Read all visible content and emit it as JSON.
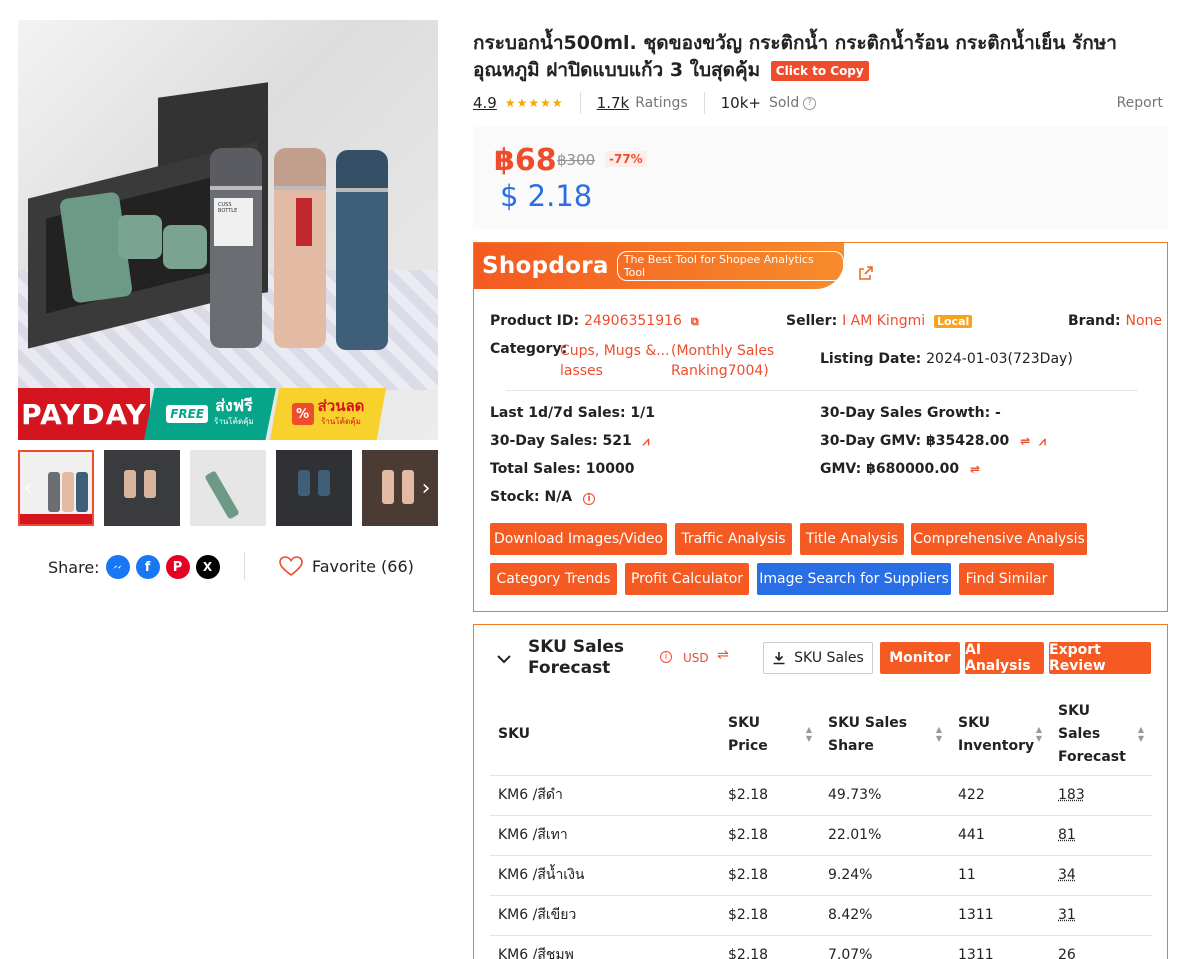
{
  "product": {
    "title": "กระบอกน้ำ500ml. ชุดของขวัญ กระติกน้ำ กระติกน้ำร้อน กระติกน้ำเย็น รักษาอุณหภูมิ ฝาปิดแบบแก้ว 3 ใบสุดคุ้ม",
    "copy_label": "Click to Copy",
    "rating": "4.9",
    "stars": "★★★★★",
    "ratings_count": "1.7k",
    "ratings_label": "Ratings",
    "sold_count": "10k+",
    "sold_label": "Sold",
    "report_label": "Report",
    "price": "฿68",
    "original_price": "฿300",
    "discount": "-77%",
    "price_usd": "$ 2.18"
  },
  "gallery": {
    "banner": {
      "payday": "PAYDAY",
      "free": "FREE",
      "free_ship": "ส่งฟรี",
      "free_ship_sub": "ร้านโค้ดคุ้ม",
      "discount": "ส่วนลด",
      "discount_sub": "ร้านโค้ดคุ้ม",
      "percent": "%"
    },
    "bottle_label": "CUSS BOTTLE",
    "prev_icon": "‹",
    "next_icon": "›"
  },
  "share": {
    "label": "Share:",
    "favorite_label": "Favorite (66)"
  },
  "shopdora": {
    "logo": "Shopdora",
    "tagline": "The Best Tool for Shopee Analytics Tool",
    "product_id_label": "Product ID:",
    "product_id": "24906351916",
    "seller_label": "Seller:",
    "seller": "I AM Kingmi",
    "seller_badge": "Local",
    "brand_label": "Brand:",
    "brand": "None",
    "category_label": "Category:",
    "category_line1": "Cups, Mugs &...",
    "category_line2": "lasses",
    "ranking_line1": "(Monthly Sales",
    "ranking_line2": "Ranking7004)",
    "listing_date_label": "Listing Date:",
    "listing_date": "2024-01-03(723Day)",
    "last_sales": "Last 1d/7d Sales: 1/1",
    "growth": "30-Day Sales Growth: -",
    "sales_30": "30-Day Sales: 521",
    "gmv_30": "30-Day GMV: ฿35428.00",
    "total_sales": "Total Sales: 10000",
    "gmv": "GMV: ฿680000.00",
    "stock": "Stock: N/A",
    "buttons": [
      "Download Images/Video",
      "Traffic Analysis",
      "Title Analysis",
      "Comprehensive Analysis",
      "Category Trends",
      "Profit Calculator",
      "Image Search for Suppliers",
      "Find Similar"
    ]
  },
  "sku": {
    "title": "SKU Sales Forecast",
    "currency": "USD",
    "sku_sales_btn": "SKU Sales",
    "monitor_btn": "Monitor",
    "ai_btn": "AI Analysis",
    "export_btn": "Export Review",
    "headers": [
      "SKU",
      "SKU Price",
      "SKU Sales Share",
      "SKU Inventory",
      "SKU Sales Forecast"
    ],
    "rows": [
      {
        "sku": "KM6 /สีดำ",
        "price": "$2.18",
        "share": "49.73%",
        "inventory": "422",
        "forecast": "183"
      },
      {
        "sku": "KM6 /สีเทา",
        "price": "$2.18",
        "share": "22.01%",
        "inventory": "441",
        "forecast": "81"
      },
      {
        "sku": "KM6 /สีน้ำเงิน",
        "price": "$2.18",
        "share": "9.24%",
        "inventory": "11",
        "forecast": "34"
      },
      {
        "sku": "KM6 /สีเขียว",
        "price": "$2.18",
        "share": "8.42%",
        "inventory": "1311",
        "forecast": "31"
      },
      {
        "sku": "KM6 /สีชมพู",
        "price": "$2.18",
        "share": "7.07%",
        "inventory": "1311",
        "forecast": "26"
      }
    ]
  },
  "colors": {
    "accent": "#ee4d2d",
    "shopdora_orange": "#f45a21",
    "usd_blue": "#2a6ee6"
  }
}
